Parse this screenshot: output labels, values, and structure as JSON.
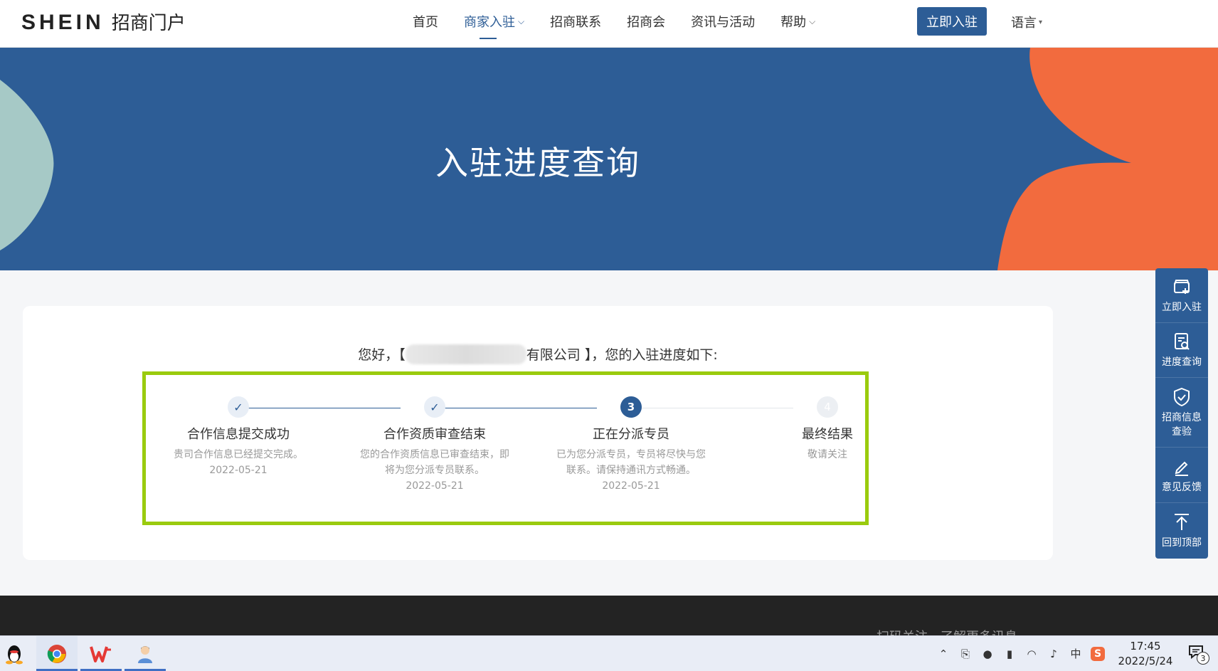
{
  "header": {
    "brand": "SHEIN",
    "portal": "招商门户",
    "nav": [
      "首页",
      "商家入驻",
      "招商联系",
      "招商会",
      "资讯与活动",
      "帮助"
    ],
    "join_button": "立即入驻",
    "language": "语言"
  },
  "banner": {
    "title": "入驻进度查询"
  },
  "progress": {
    "greeting_prefix": "您好，【",
    "company_visible": "有限公司",
    "greeting_suffix": "】，您的入驻进度如下:",
    "steps": [
      {
        "status": "done",
        "marker": "✓",
        "title": "合作信息提交成功",
        "desc": "贵司合作信息已经提交完成。",
        "date": "2022-05-21"
      },
      {
        "status": "done",
        "marker": "✓",
        "title": "合作资质审查结束",
        "desc": "您的合作资质信息已审查结束，即将为您分派专员联系。",
        "date": "2022-05-21"
      },
      {
        "status": "current",
        "marker": "3",
        "title": "正在分派专员",
        "desc": "已为您分派专员，专员将尽快与您联系。请保持通讯方式畅通。",
        "date": "2022-05-21"
      },
      {
        "status": "pending",
        "marker": "4",
        "title": "最终结果",
        "desc": "敬请关注",
        "date": ""
      }
    ]
  },
  "sidebar": {
    "items": [
      {
        "label": "立即入驻",
        "icon": "store-add-icon"
      },
      {
        "label": "进度查询",
        "icon": "document-search-icon"
      },
      {
        "label": "招商信息查验",
        "icon": "shield-check-icon"
      },
      {
        "label": "意见反馈",
        "icon": "pen-icon"
      },
      {
        "label": "回到顶部",
        "icon": "arrow-up-icon"
      }
    ]
  },
  "footer": {
    "text": "扫码关注，了解更多讯息"
  },
  "taskbar": {
    "time": "17:45",
    "date": "2022/5/24",
    "ime": "中",
    "notification_count": "3"
  },
  "colors": {
    "primary": "#2d5d96",
    "highlight_frame": "#9acb0e",
    "orange": "#f26b3e",
    "teal": "#a6c9c6"
  }
}
